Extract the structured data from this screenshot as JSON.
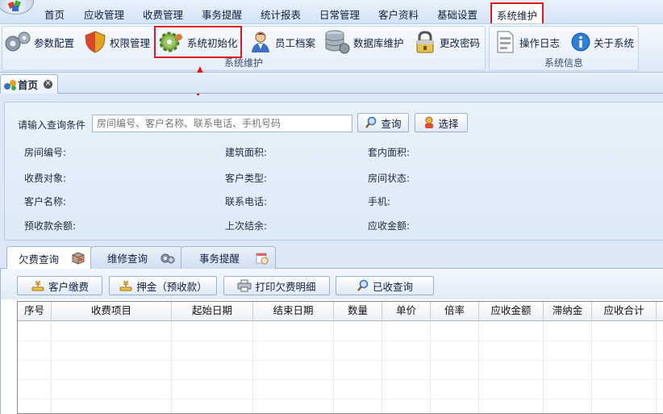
{
  "menubar": {
    "items": [
      "首页",
      "应收管理",
      "收费管理",
      "事务提醒",
      "统计报表",
      "日常管理",
      "客户资料",
      "基础设置",
      "系统维护"
    ]
  },
  "ribbon": {
    "group1": {
      "label": "系统维护",
      "buttons": [
        "参数配置",
        "权限管理",
        "系统初始化",
        "员工档案",
        "数据库维护",
        "更改密码"
      ]
    },
    "group2": {
      "label": "系统信息",
      "buttons": [
        "操作日志",
        "关于系统"
      ]
    }
  },
  "doc_tab": {
    "label": "首页"
  },
  "query": {
    "prompt": "请输入查询条件",
    "placeholder": "房间编号、客户名称、联系电话、手机号码",
    "search_button": "查询",
    "select_button": "选择",
    "fields": [
      [
        "房间编号:",
        "建筑面积:",
        "套内面积:"
      ],
      [
        "收费对象:",
        "客户类型:",
        "房间状态:"
      ],
      [
        "客户名称:",
        "联系电话:",
        "手机:"
      ],
      [
        "预收款余额:",
        "上次结余:",
        "应收金额:"
      ]
    ]
  },
  "sub_tabs": [
    "欠费查询",
    "维修查询",
    "事务提醒"
  ],
  "toolbar": {
    "buttons": [
      "客户缴费",
      "押金（预收款）",
      "打印欠费明细",
      "已收查询"
    ]
  },
  "table": {
    "columns": [
      "序号",
      "收费项目",
      "起始日期",
      "结束日期",
      "数量",
      "单价",
      "倍率",
      "应收金额",
      "滞纳金",
      "应收合计"
    ],
    "rows": []
  },
  "colors": {
    "highlight": "#e0191e",
    "accent": "#4a7ebb"
  }
}
